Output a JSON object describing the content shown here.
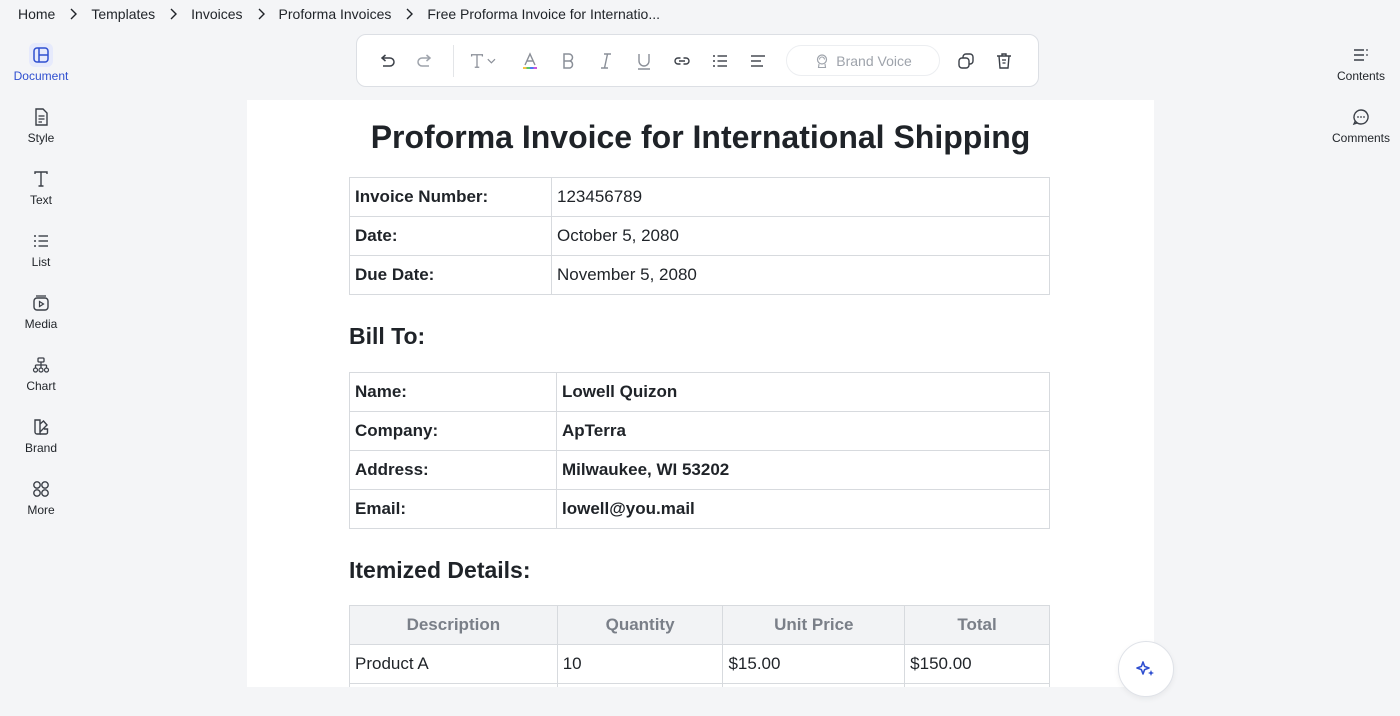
{
  "breadcrumb": [
    "Home",
    "Templates",
    "Invoices",
    "Proforma Invoices",
    "Free Proforma Invoice for Internatio..."
  ],
  "left_sidebar": [
    {
      "label": "Document",
      "icon": "document-layout-icon"
    },
    {
      "label": "Style",
      "icon": "style-icon"
    },
    {
      "label": "Text",
      "icon": "text-icon"
    },
    {
      "label": "List",
      "icon": "list-icon"
    },
    {
      "label": "Media",
      "icon": "media-icon"
    },
    {
      "label": "Chart",
      "icon": "chart-icon"
    },
    {
      "label": "Brand",
      "icon": "brand-icon"
    },
    {
      "label": "More",
      "icon": "more-grid-icon"
    }
  ],
  "right_sidebar": [
    {
      "label": "Contents",
      "icon": "contents-icon"
    },
    {
      "label": "Comments",
      "icon": "comments-icon"
    }
  ],
  "toolbar": {
    "brand_voice_label": "Brand Voice"
  },
  "document": {
    "title": "Proforma Invoice for International Shipping",
    "invoice_info": [
      {
        "key": "Invoice Number:",
        "value": "123456789"
      },
      {
        "key": "Date:",
        "value": "October 5, 2080"
      },
      {
        "key": "Due Date:",
        "value": "November 5, 2080"
      }
    ],
    "bill_to_heading": "Bill To:",
    "bill_to": [
      {
        "key": "Name:",
        "value": "Lowell Quizon"
      },
      {
        "key": "Company:",
        "value": "ApTerra"
      },
      {
        "key": "Address:",
        "value": "Milwaukee, WI 53202"
      },
      {
        "key": "Email:",
        "value": "lowell@you.mail"
      }
    ],
    "items_heading": "Itemized Details:",
    "items_columns": [
      "Description",
      "Quantity",
      "Unit Price",
      "Total"
    ],
    "items_rows": [
      [
        "Product A",
        "10",
        "$15.00",
        "$150.00"
      ],
      [
        "",
        "",
        "",
        ""
      ]
    ]
  },
  "colors": {
    "accent": "#2f4fd0",
    "background": "#f4f5f7"
  }
}
